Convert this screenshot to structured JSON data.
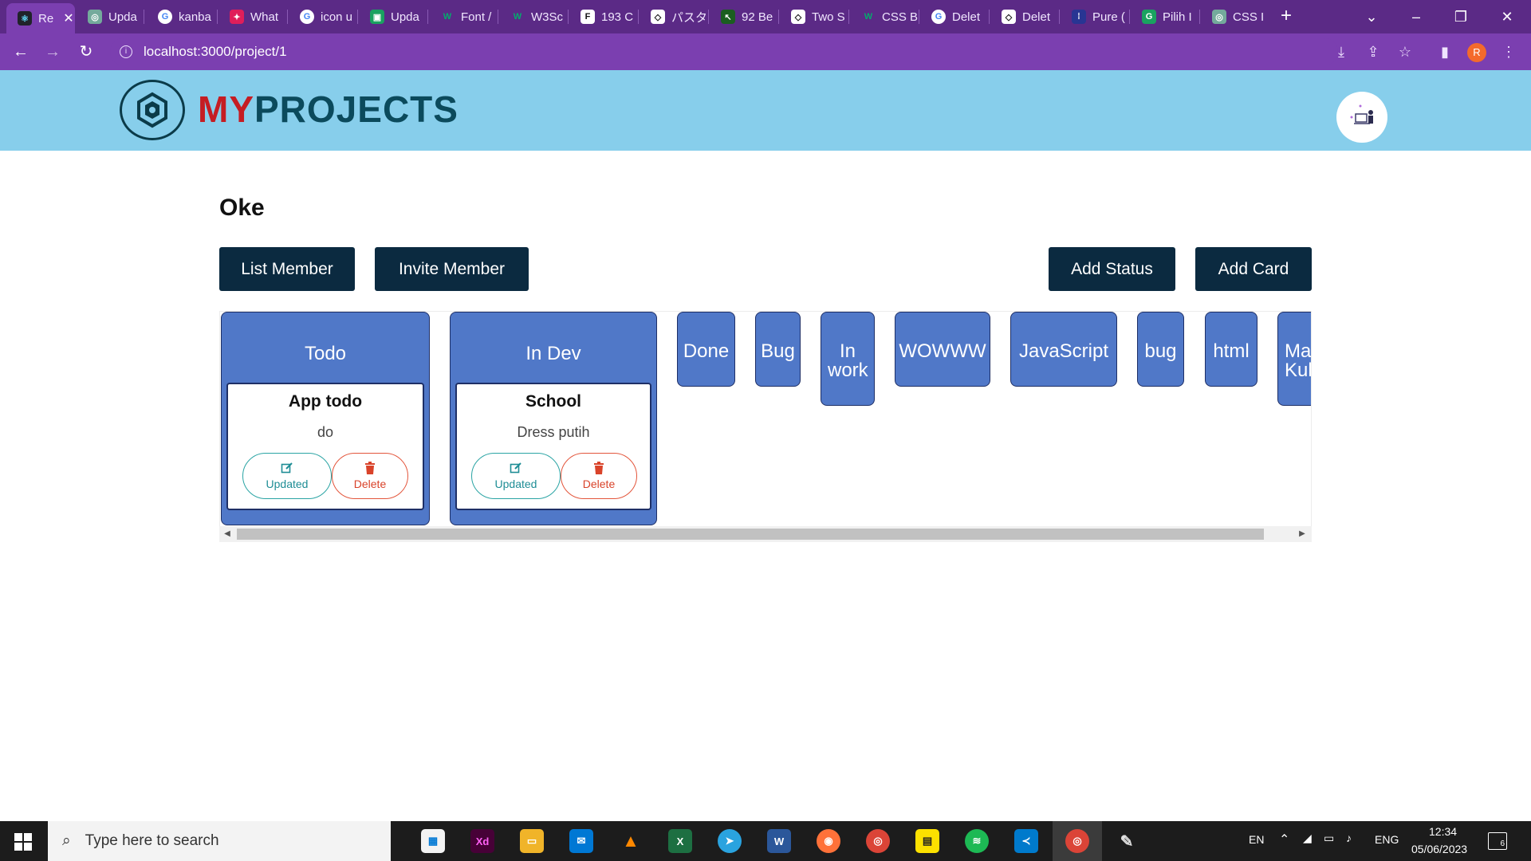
{
  "browser": {
    "tabs": [
      {
        "label": "Re",
        "icon": "react-icon",
        "color": "#61dafb",
        "active": true
      },
      {
        "label": "Upda",
        "icon": "openai-icon",
        "color": "#74aa9c"
      },
      {
        "label": "kanba",
        "icon": "google-icon",
        "color": "#ffffff"
      },
      {
        "label": "What",
        "icon": "slack-icon",
        "color": "#e01e5a"
      },
      {
        "label": "icon u",
        "icon": "google-icon",
        "color": "#ffffff"
      },
      {
        "label": "Upda",
        "icon": "green-app-icon",
        "color": "#1aa260"
      },
      {
        "label": "Font /",
        "icon": "w3-icon",
        "color": "#04aa6d"
      },
      {
        "label": "W3Sc",
        "icon": "w3-icon",
        "color": "#04aa6d"
      },
      {
        "label": "193 C",
        "icon": "f-icon",
        "color": "#222222"
      },
      {
        "label": "パスタ",
        "icon": "codepen-icon",
        "color": "#222222"
      },
      {
        "label": "92 Be",
        "icon": "cursor-icon",
        "color": "#1b5e20"
      },
      {
        "label": "Two S",
        "icon": "codepen-icon",
        "color": "#222222"
      },
      {
        "label": "CSS B",
        "icon": "w3-icon",
        "color": "#04aa6d"
      },
      {
        "label": "Delet",
        "icon": "google-icon",
        "color": "#ffffff"
      },
      {
        "label": "Delet",
        "icon": "codepen-icon",
        "color": "#222222"
      },
      {
        "label": "Pure (",
        "icon": "dots-icon",
        "color": "#283593"
      },
      {
        "label": "Pilih I",
        "icon": "g-icon",
        "color": "#1aa260"
      },
      {
        "label": "CSS I",
        "icon": "openai-icon",
        "color": "#74aa9c"
      }
    ],
    "url": "localhost:3000/project/1",
    "profile_initial": "R"
  },
  "header": {
    "logo_my": "MY",
    "logo_projects": "PROJECTS"
  },
  "project": {
    "title": "Oke",
    "buttons": {
      "list_member": "List Member",
      "invite_member": "Invite Member",
      "add_status": "Add Status",
      "add_card": "Add Card"
    },
    "columns": [
      {
        "title": "Todo",
        "cards": [
          {
            "title": "App todo",
            "desc": "do",
            "update": "Updated",
            "delete": "Delete"
          }
        ]
      },
      {
        "title": "In Dev",
        "cards": [
          {
            "title": "School",
            "desc": "Dress putih",
            "update": "Updated",
            "delete": "Delete"
          }
        ]
      },
      {
        "title": "Done"
      },
      {
        "title": "Bug"
      },
      {
        "title": "In work"
      },
      {
        "title": "WOWWW"
      },
      {
        "title": "JavaScript"
      },
      {
        "title": "bug"
      },
      {
        "title": "html"
      },
      {
        "title": "Ma Kul"
      }
    ]
  },
  "taskbar": {
    "search_placeholder": "Type here to search",
    "lang_short": "EN",
    "lang": "ENG",
    "time": "12:34",
    "date": "05/06/2023",
    "notifications": "6"
  }
}
